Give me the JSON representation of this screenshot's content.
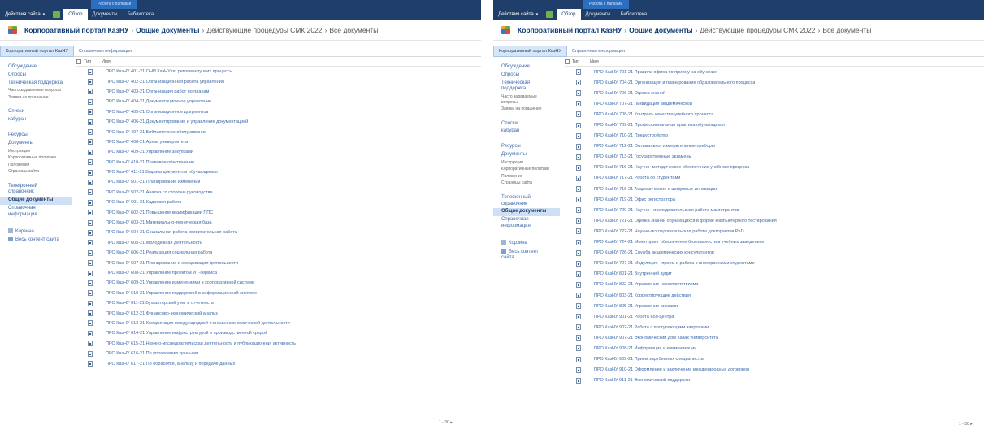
{
  "colors": {
    "ribbon": "#1f3f6a",
    "ribbon_context": "#2d6fbf",
    "link": "#3d6aa8",
    "selected_bg": "#cfe0f4"
  },
  "left": {
    "ribbon": {
      "context_group": "Работа с папками",
      "site_actions": "Действия сайта",
      "tabs": [
        "Обзор",
        "Документы",
        "Библиотека"
      ]
    },
    "breadcrumb": {
      "site": "Корпоративный портал КазНУ",
      "library": "Общие документы",
      "folder": "Действующие процедуры СМК 2022",
      "view": "Все документы"
    },
    "topnav": [
      "Корпоративный портал КазНУ",
      "Справочная информация"
    ],
    "quicklaunch": [
      {
        "label": "Обсуждение",
        "kind": "item"
      },
      {
        "label": "Опросы",
        "kind": "item"
      },
      {
        "label": "Техническая поддержка",
        "kind": "item"
      },
      {
        "label": "Часто задаваемые вопросы",
        "kind": "small"
      },
      {
        "label": "Заявки на погашение",
        "kind": "small"
      },
      {
        "label": "Списки",
        "kind": "head"
      },
      {
        "label": "кабуран",
        "kind": "item"
      },
      {
        "label": "Ресурсы",
        "kind": "head"
      },
      {
        "label": "Документы",
        "kind": "item"
      },
      {
        "label": "Инструкции",
        "kind": "small"
      },
      {
        "label": "Корпоративные политики",
        "kind": "small"
      },
      {
        "label": "Положения",
        "kind": "small"
      },
      {
        "label": "Страницы сайта",
        "kind": "small"
      },
      {
        "label": "Телефонный справочник",
        "kind": "head"
      },
      {
        "label": "Общие документы",
        "kind": "selected"
      },
      {
        "label": "Справочная информация",
        "kind": "item"
      },
      {
        "label": "Корзина",
        "kind": "icon"
      },
      {
        "label": "Весь контент сайта",
        "kind": "icon"
      }
    ],
    "list_header": {
      "type": "Тип",
      "name": "Имя"
    },
    "documents": [
      "ПРО КазНУ 401-21 ОНИ КазНУ по регламенту и их процессы",
      "ПРО КазНУ 402-21 Организационная работа управления",
      "ПРО КазНУ 403-21 Организация работ по планам",
      "ПРО КазНУ 404-21 Документационное управление",
      "ПРО КазНУ 405-21 Организационное документов",
      "ПРО КазНУ 406-21 Документирование и управление документацией",
      "ПРО КазНУ 407-21 Библиотечное обслуживание",
      "ПРО КазНУ 408-21 Архив университета",
      "ПРО КазНУ 409-21 Управление закупками",
      "ПРО КазНУ 410-21 Правовое обеспечение",
      "ПРО КазНУ 411-21 Выдача документов обучающимся",
      "ПРО КазНУ 501-21 Планирование изменений",
      "ПРО КазНУ 502-21 Анализ со стороны руководства",
      "ПРО КазНУ 601-21 Кадровая работа",
      "ПРО КазНУ 602-21 Повышение квалификации ППС",
      "ПРО КазНУ 603-21 Материально-техническая база",
      "ПРО КазНУ 604-21 Социальная работа воспитательная работа",
      "ПРО КазНУ 605-21 Молодежная деятельность",
      "ПРО КазНУ 606-21 Реализация социальная работа",
      "ПРО КазНУ 607-21 Планирование и координация деятельности",
      "ПРО КазНУ 608-21 Управление проектом ИТ-сервиса",
      "ПРО КазНУ 609-21 Управление изменениями в корпоративной системе",
      "ПРО КазНУ 610-21 Управление поддержкой в информационной системе",
      "ПРО КазНУ 611-21 Бухгалтерский учет и отчетность",
      "ПРО КазНУ 612-21 Финансово-экономический анализ",
      "ПРО КазНУ 613-21 Координация международной и внешнеэкономической деятельности",
      "ПРО КазНУ 614-21 Управление инфраструктурой и производственной средой",
      "ПРО КазНУ 615-21 Научно-исследовательская деятельность и публикационная активность",
      "ПРО КазНУ 616-21 По управлению данными",
      "ПРО КазНУ 617-21 По обработке, анализу и передаче данных"
    ],
    "pager": "1 - 30"
  },
  "right": {
    "ribbon": {
      "context_group": "Работа с папками",
      "site_actions": "Действия сайта",
      "tabs": [
        "Обзор",
        "Документы",
        "Библиотека"
      ]
    },
    "breadcrumb": {
      "site": "Корпоративный портал КазНУ",
      "library": "Общие документы",
      "folder": "Действующие процедуры СМК 2022",
      "view": "Все документы"
    },
    "topnav": [
      "Корпоративный портал КазНУ",
      "Справочная информация"
    ],
    "quicklaunch": [
      {
        "label": "Обсуждение",
        "kind": "item"
      },
      {
        "label": "Опросы",
        "kind": "item"
      },
      {
        "label": "Техническая поддержка",
        "kind": "item"
      },
      {
        "label": "Часто задаваемые вопросы",
        "kind": "small"
      },
      {
        "label": "Заявки на погашение",
        "kind": "small"
      },
      {
        "label": "Списки",
        "kind": "head"
      },
      {
        "label": "кабуран",
        "kind": "item"
      },
      {
        "label": "Ресурсы",
        "kind": "head"
      },
      {
        "label": "Документы",
        "kind": "item"
      },
      {
        "label": "Инструкции",
        "kind": "small"
      },
      {
        "label": "Корпоративные политики",
        "kind": "small"
      },
      {
        "label": "Положения",
        "kind": "small"
      },
      {
        "label": "Страницы сайта",
        "kind": "small"
      },
      {
        "label": "Телефонный справочник",
        "kind": "head"
      },
      {
        "label": "Общие документы",
        "kind": "selected"
      },
      {
        "label": "Справочная информация",
        "kind": "item"
      },
      {
        "label": "Корзина",
        "kind": "icon"
      },
      {
        "label": "Весь контент сайта",
        "kind": "icon"
      }
    ],
    "list_header": {
      "type": "Тип",
      "name": "Имя"
    },
    "documents": [
      "ПРО КазНУ 701-21 Правила офиса по приему на обучение",
      "ПРО КазНУ 704-21 Организация и планирование образовательного процесса",
      "ПРО КазНУ 706-21 Оценка знаний",
      "ПРО КазНУ 707-21 Ликвидация академической",
      "ПРО КазНУ 708-21 Контроль качества учебного процесса",
      "ПРО КазНУ 709-21 Профессиональная практика обучающихся",
      "ПРО КазНУ 710-21 Предустройство",
      "ПРО КазНУ 712-21 Оптимально- измерительные приборы",
      "ПРО КазНУ 713-21 Государственные экзамены",
      "ПРО КазНУ 716-21 Научно- методическое обеспечение учебного процесса",
      "ПРО КазНУ 717-21 Работа со студентами",
      "ПРО КазНУ 718-21 Академические и цифровые инновации",
      "ПРО КазНУ 719-21 Офис регистратора",
      "ПРО КазНУ 720-21 Научно - исследовательская работа магистрантов",
      "ПРО КазНУ 721-21 Оценка знаний обучающихся в форме компьютерного тестирования",
      "ПРО КазНУ 722-21 Научно-исследовательская работа докторантов PhD",
      "ПРО КазНУ 724-21 Мониторинг обеспечения безопасности в учебных заведениях",
      "ПРО КазНУ 726-21 Служба академических консультантов",
      "ПРО КазНУ 727-21 Модуляция - прием и работа с иностранными студентами",
      "ПРО КазНУ 801-21 Внутренний аудит",
      "ПРО КазНУ 802-21 Управление несоответствиями",
      "ПРО КазНУ 803-21 Корректирующие действия",
      "ПРО КазНУ 805-21 Управление рисками",
      "ПРО КазНУ 901-21 Работа Кол-центра",
      "ПРО КазНУ 902-21 Работа с поступающими запросами",
      "ПРО КазНУ 907-21 Экономический дом Казах университета",
      "ПРО КазНУ 908-21 Информация и коммуникации",
      "ПРО КазНУ 909-21 Прием зарубежных специалистов",
      "ПРО КазНУ 910-21 Оформление и заключение международных договоров",
      "ПРО КазНУ 911-21 Экономический поддержки"
    ],
    "pager": "1 - 30"
  }
}
